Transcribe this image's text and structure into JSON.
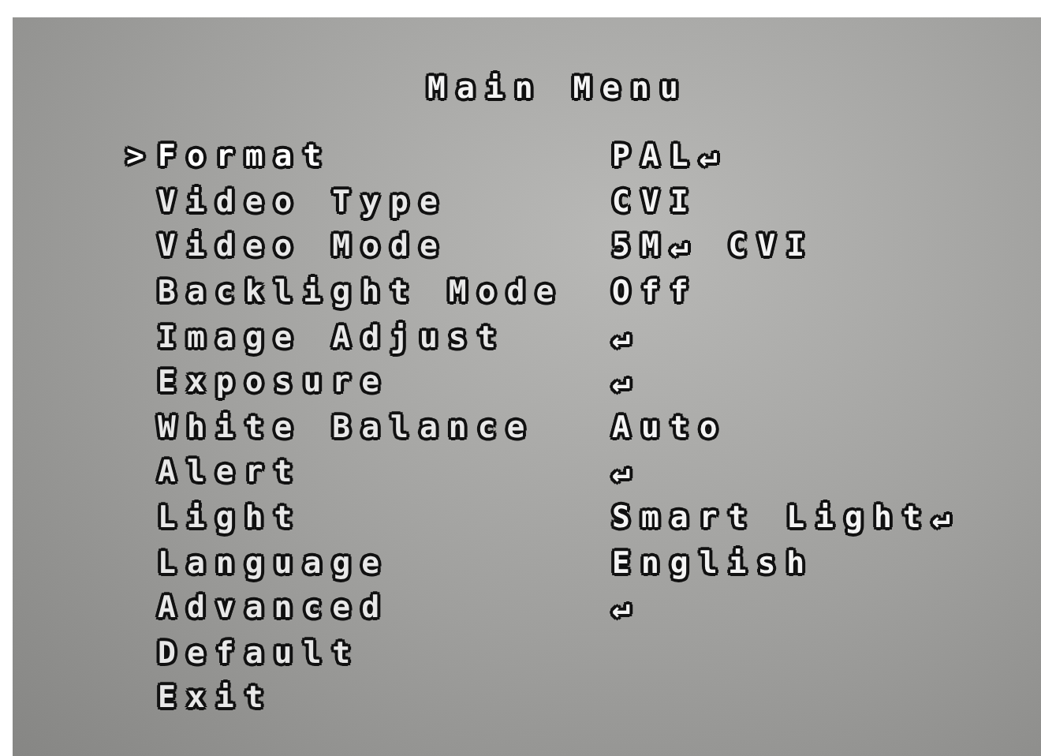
{
  "title": "Main Menu",
  "cursor": ">",
  "items": [
    {
      "label": "Format",
      "value": "PAL↵",
      "selected": true
    },
    {
      "label": "Video Type",
      "value": "CVI",
      "selected": false
    },
    {
      "label": "Video Mode",
      "value": "5M↵ CVI",
      "selected": false
    },
    {
      "label": "Backlight Mode",
      "value": "Off",
      "selected": false
    },
    {
      "label": "Image Adjust",
      "value": "↵",
      "selected": false
    },
    {
      "label": "Exposure",
      "value": "↵",
      "selected": false
    },
    {
      "label": "White Balance",
      "value": "Auto",
      "selected": false
    },
    {
      "label": "Alert",
      "value": "↵",
      "selected": false
    },
    {
      "label": "Light",
      "value": "Smart Light↵",
      "selected": false
    },
    {
      "label": "Language",
      "value": "English",
      "selected": false
    },
    {
      "label": "Advanced",
      "value": "↵",
      "selected": false
    },
    {
      "label": "Default",
      "selected": false
    },
    {
      "label": "Exit",
      "selected": false
    }
  ]
}
